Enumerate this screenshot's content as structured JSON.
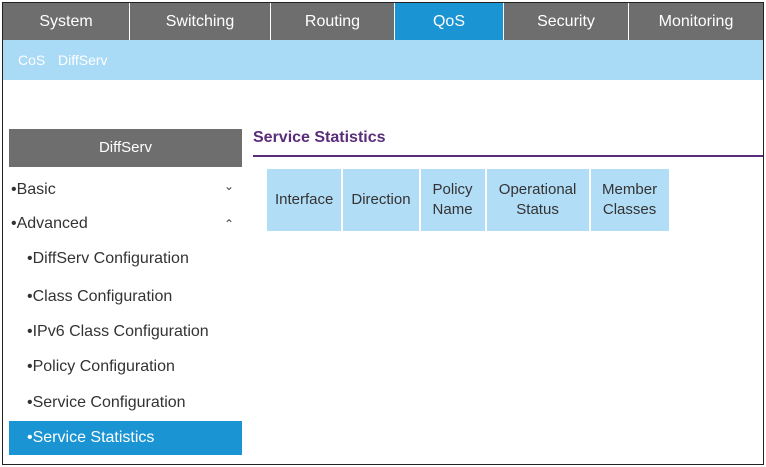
{
  "top_tabs": [
    {
      "label": "System",
      "active": false
    },
    {
      "label": "Switching",
      "active": false
    },
    {
      "label": "Routing",
      "active": false
    },
    {
      "label": "QoS",
      "active": true
    },
    {
      "label": "Security",
      "active": false
    },
    {
      "label": "Monitoring",
      "active": false
    }
  ],
  "sub_tabs": [
    "CoS",
    "DiffServ"
  ],
  "sidebar": {
    "header": "DiffServ",
    "items": [
      {
        "label": "Basic",
        "bullet": "•",
        "chevron": "⌄"
      },
      {
        "label": "Advanced",
        "bullet": "•",
        "chevron": "⌃"
      },
      {
        "label": "DiffServ Configuration",
        "bullet": "•"
      },
      {
        "label": "Class Configuration",
        "bullet": "•"
      },
      {
        "label": "IPv6 Class Configuration",
        "bullet": "•"
      },
      {
        "label": "Policy Configuration",
        "bullet": "•"
      },
      {
        "label": "Service Configuration",
        "bullet": "•"
      },
      {
        "label": "Service Statistics",
        "bullet": "•",
        "active": true
      }
    ]
  },
  "main": {
    "title": "Service Statistics",
    "columns": [
      "Interface",
      "Direction",
      "Policy Name",
      "Operational Status",
      "Member Classes"
    ]
  },
  "colors": {
    "nav_gray": "#6e6e6e",
    "accent_blue": "#1a94d2",
    "subnav_blue": "#a9daf6",
    "table_header_blue": "#b2ddf6",
    "title_purple": "#5a2d7a"
  }
}
